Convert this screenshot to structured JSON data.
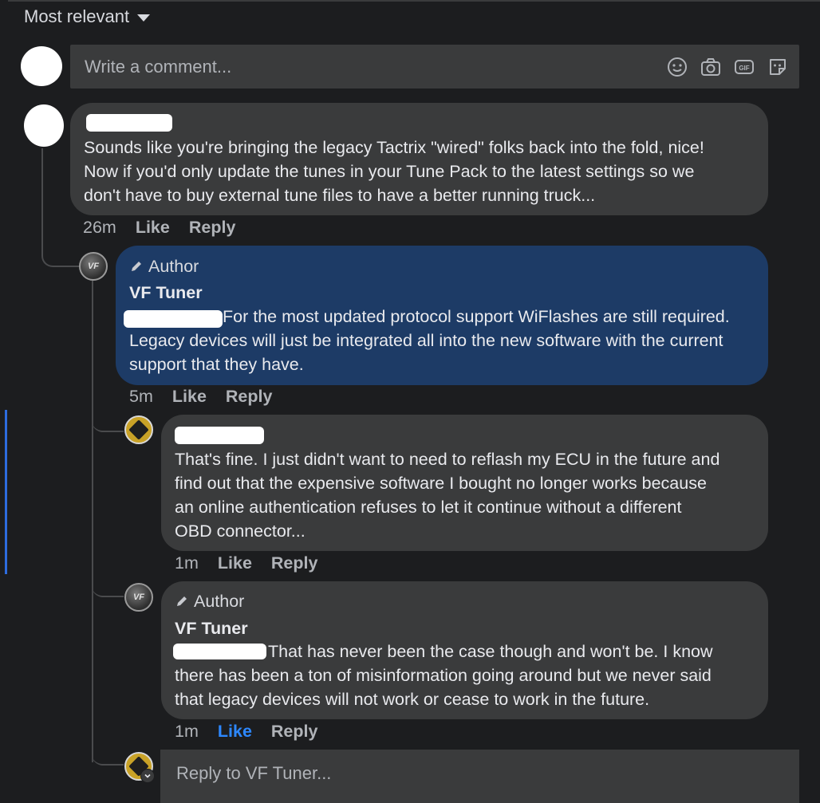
{
  "sort": {
    "label": "Most relevant",
    "icon": "caret-down-icon"
  },
  "composer": {
    "placeholder": "Write a comment...",
    "icons": [
      "emoji-icon",
      "camera-icon",
      "gif-icon",
      "sticker-icon"
    ]
  },
  "comments": [
    {
      "author": "",
      "text": "Sounds like you're bringing the legacy Tactrix \"wired\" folks back into the fold, nice! Now if you'd only update the tunes in your Tune Pack to the latest settings so we don't have to buy external tune files to have a better running truck...",
      "lines": [
        "Sounds like you're bringing the legacy Tactrix \"wired\" folks back into the fold, nice!",
        "Now if you'd only update the tunes in your Tune Pack to the latest settings so we",
        "don't have to buy external tune files to have a better running truck..."
      ],
      "time": "26m",
      "like": "Like",
      "reply": "Reply"
    },
    {
      "badge": "Author",
      "author": "VF Tuner",
      "lines": [
        "For the most updated protocol support WiFlashes are still required.",
        "Legacy devices will just be integrated all into the new software with the current",
        "support that they have."
      ],
      "time": "5m",
      "like": "Like",
      "reply": "Reply"
    },
    {
      "author": "",
      "lines": [
        "That's fine. I just didn't want to need to reflash my ECU in the future and",
        "find out that the expensive software I bought no longer works because",
        "an online authentication refuses to let it continue without a different",
        "OBD connector..."
      ],
      "time": "1m",
      "like": "Like",
      "reply": "Reply"
    },
    {
      "badge": "Author",
      "author": "VF Tuner",
      "lines": [
        "That has never been the case though and won't be. I know",
        "there has been a ton of misinformation going around but we never said",
        "that legacy devices will not work or cease to work in the future."
      ],
      "time": "1m",
      "like": "Like",
      "reply": "Reply",
      "liked": true
    }
  ],
  "reply_box": {
    "placeholder": "Reply to VF Tuner..."
  },
  "colors": {
    "background": "#1c1d1f",
    "bubble": "#3a3b3c",
    "author_bubble": "#1d3b66",
    "like_active": "#2d88ff"
  }
}
